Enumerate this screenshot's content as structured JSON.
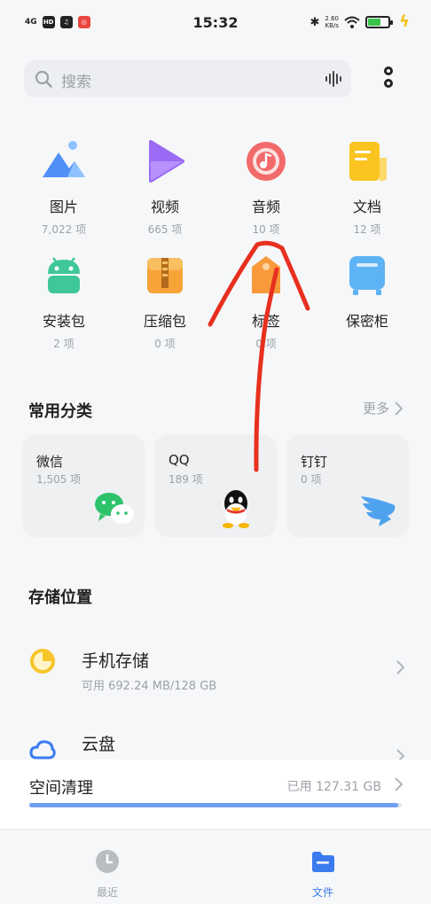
{
  "status_bar": {
    "signal": "4G",
    "badge_hd": "HD",
    "time": "15:32",
    "speed_value": "2.60",
    "speed_unit": "KB/s"
  },
  "search": {
    "placeholder": "搜索"
  },
  "categories": [
    {
      "name": "图片",
      "count": "7,022 项",
      "icon": "picture-icon"
    },
    {
      "name": "视频",
      "count": "665 项",
      "icon": "video-icon"
    },
    {
      "name": "音频",
      "count": "10 项",
      "icon": "audio-icon"
    },
    {
      "name": "文档",
      "count": "12 项",
      "icon": "document-icon"
    },
    {
      "name": "安装包",
      "count": "2 项",
      "icon": "android-icon"
    },
    {
      "name": "压缩包",
      "count": "0 项",
      "icon": "archive-icon"
    },
    {
      "name": "标签",
      "count": "0 项",
      "icon": "tag-icon"
    },
    {
      "name": "保密柜",
      "count": "",
      "icon": "safe-icon"
    }
  ],
  "common": {
    "title": "常用分类",
    "more": "更多",
    "cards": [
      {
        "title": "微信",
        "count": "1,505 项",
        "icon": "wechat-icon"
      },
      {
        "title": "QQ",
        "count": "189 项",
        "icon": "qq-icon"
      },
      {
        "title": "钉钉",
        "count": "0 项",
        "icon": "dingtalk-icon"
      }
    ]
  },
  "storage": {
    "title": "存储位置",
    "phone": {
      "title": "手机存储",
      "sub": "可用 692.24 MB/128 GB"
    },
    "cloud": {
      "title": "云盘"
    }
  },
  "clean": {
    "label": "空间清理",
    "used": "已用 127.31 GB",
    "used_fraction": 0.99
  },
  "tabs": [
    {
      "label": "最近",
      "active": false
    },
    {
      "label": "文件",
      "active": true
    }
  ],
  "colors": {
    "accent": "#3b7bf0",
    "annotation": "#e8301f"
  }
}
